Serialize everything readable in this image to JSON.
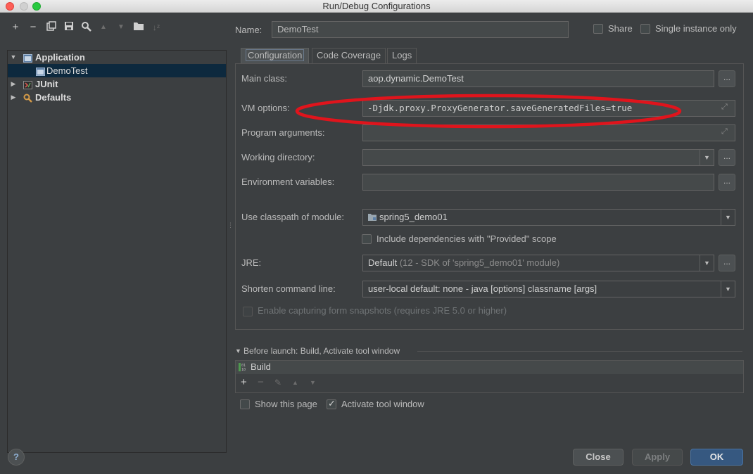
{
  "window": {
    "title": "Run/Debug Configurations"
  },
  "toolbar": {
    "icons": [
      "add-icon",
      "remove-icon",
      "copy-icon",
      "save-icon",
      "edit-defaults-icon",
      "move-up-icon",
      "move-down-icon",
      "folder-icon",
      "sort-icon"
    ]
  },
  "tree": {
    "items": [
      {
        "label": "Application",
        "expanded": true
      },
      {
        "label": "DemoTest",
        "selected": true
      },
      {
        "label": "JUnit",
        "expanded": false
      },
      {
        "label": "Defaults",
        "expanded": false
      }
    ]
  },
  "header": {
    "name_label": "Name:",
    "name_value": "DemoTest",
    "share_label": "Share",
    "single_instance_label": "Single instance only"
  },
  "tabs": [
    {
      "label": "Configuration",
      "active": true
    },
    {
      "label": "Code Coverage",
      "active": false
    },
    {
      "label": "Logs",
      "active": false
    }
  ],
  "form": {
    "main_class_label": "Main class:",
    "main_class_value": "aop.dynamic.DemoTest",
    "vm_options_label": "VM options:",
    "vm_options_value": "-Djdk.proxy.ProxyGenerator.saveGeneratedFiles=true",
    "program_args_label": "Program arguments:",
    "working_dir_label": "Working directory:",
    "env_vars_label": "Environment variables:",
    "classpath_label": "Use classpath of module:",
    "classpath_value": "spring5_demo01",
    "include_deps_label": "Include dependencies with \"Provided\" scope",
    "jre_label": "JRE:",
    "jre_value_main": "Default",
    "jre_value_detail": "(12 - SDK of 'spring5_demo01' module)",
    "shorten_label": "Shorten command line:",
    "shorten_value": "user-local default: none - java [options] classname [args]",
    "capture_label": "Enable capturing form snapshots (requires JRE 5.0 or higher)",
    "dots": "..."
  },
  "before_launch": {
    "header": "Before launch: Build, Activate tool window",
    "task": "Build"
  },
  "options": {
    "show_page_label": "Show this page",
    "activate_label": "Activate tool window"
  },
  "buttons": {
    "help": "?",
    "close": "Close",
    "apply": "Apply",
    "ok": "OK"
  },
  "colors": {
    "annotation_ellipse": "#e0141c",
    "ok_button": "#365880",
    "selection": "#0d293e"
  }
}
